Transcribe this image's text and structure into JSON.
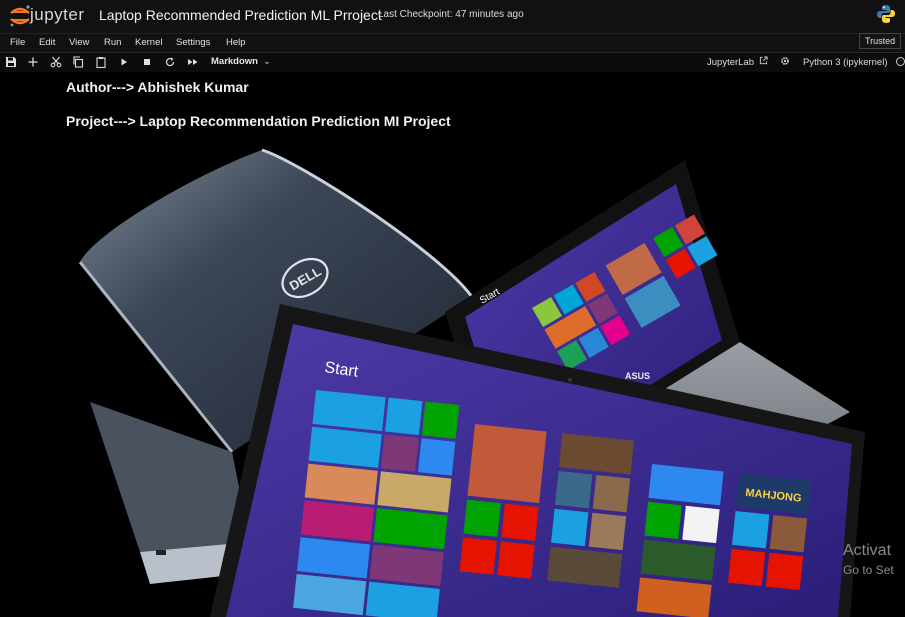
{
  "header": {
    "logo_text": "jupyter",
    "notebook_title": "Laptop Recommended Prediction ML Prroject",
    "checkpoint": "Last Checkpoint: 47 minutes ago"
  },
  "menu": {
    "items": [
      "File",
      "Edit",
      "View",
      "Run",
      "Kernel",
      "Settings",
      "Help"
    ],
    "trusted": "Trusted"
  },
  "toolbar": {
    "icons": [
      "save-icon",
      "add-cell-icon",
      "cut-icon",
      "copy-icon",
      "paste-icon",
      "run-icon",
      "stop-icon",
      "restart-icon",
      "run-all-icon"
    ],
    "cell_type": "Markdown",
    "jupyterlab_label": "JupyterLab",
    "kernel_name": "Python 3 (ipykernel)"
  },
  "cell": {
    "author_line": "Author---> Abhishek Kumar",
    "project_line": "Project---> Laptop Recommendation Prediction MI Project"
  },
  "hero_image": {
    "start_label_large": "Start",
    "start_label_small": "Start",
    "brand_logo": "DELL",
    "brand_logo_2": "ASUS",
    "game_tile_text": "MAHJONG"
  },
  "watermark": {
    "line1": "Activat",
    "line2": "Go to Set"
  },
  "colors": {
    "background": "#000000",
    "header_bg": "#111111",
    "start_screen": "#3b2a8c",
    "accent_orange": "#f37726"
  }
}
